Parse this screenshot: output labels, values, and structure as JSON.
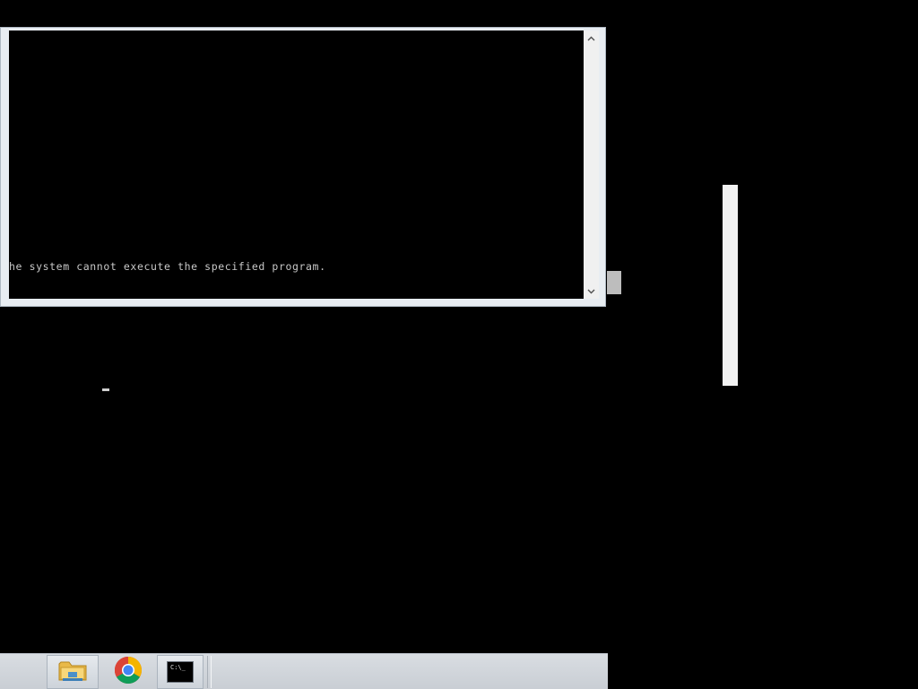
{
  "console": {
    "output_line": "he system cannot execute the specified program."
  },
  "taskbar": {
    "items": [
      {
        "name": "File Explorer",
        "icon": "folder-icon",
        "active": true
      },
      {
        "name": "Google Chrome",
        "icon": "chrome-icon",
        "active": false
      },
      {
        "name": "Command Prompt",
        "icon": "cmd-icon",
        "active": true,
        "icon_text": "C:\\_"
      }
    ]
  },
  "colors": {
    "desktop": "#000000",
    "console_text": "#c8c8c8",
    "taskbar": "#d0d5db"
  }
}
